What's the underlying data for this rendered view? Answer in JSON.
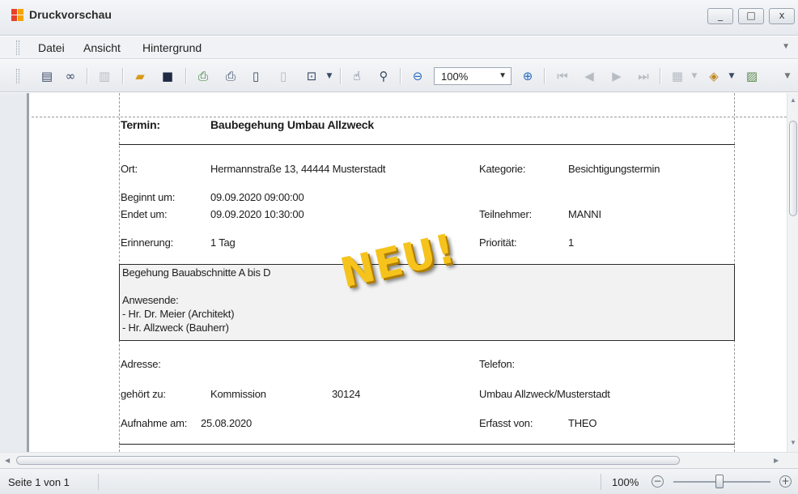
{
  "window": {
    "title": "Druckvorschau",
    "buttons": {
      "minimize": "_",
      "maximize": "□",
      "close": "x"
    }
  },
  "menu": [
    "Datei",
    "Ansicht",
    "Hintergrund"
  ],
  "toolbar": {
    "zoom_value": "100%",
    "icons": [
      "document-map-icon",
      "find-icon",
      "parameters-icon",
      "open-icon",
      "save-icon",
      "print-dialog-icon",
      "print-icon",
      "page-setup-icon",
      "scale-icon",
      "page-margins-icon",
      "hand-tool-icon",
      "magnifier-icon",
      "zoom-out-icon",
      "zoom-in-icon",
      "first-page-icon",
      "previous-page-icon",
      "next-page-icon",
      "last-page-icon",
      "multiple-pages-icon",
      "page-color-icon",
      "watermark-icon"
    ]
  },
  "report": {
    "termin_label": "Termin:",
    "termin_value": "Baubegehung Umbau Allzweck",
    "ort_label": "Ort:",
    "ort_value": "Hermannstraße 13, 44444 Musterstadt",
    "kategorie_label": "Kategorie:",
    "kategorie_value": "Besichtigungstermin",
    "beginn_label": "Beginnt um:",
    "beginn_value": "09.09.2020 09:00:00",
    "ende_label": "Endet um:",
    "ende_value": "09.09.2020 10:30:00",
    "teilnehmer_label": "Teilnehmer:",
    "teilnehmer_value": "MANNI",
    "erinnerung_label": "Erinnerung:",
    "erinnerung_value": "1 Tag",
    "prioritaet_label": "Priorität:",
    "prioritaet_value": "1",
    "notes": [
      "Begehung Bauabschnitte A bis D",
      "",
      "Anwesende:",
      "- Hr. Dr. Meier (Architekt)",
      "- Hr. Allzweck (Bauherr)"
    ],
    "adresse_label": "Adresse:",
    "telefon_label": "Telefon:",
    "gehoert_label": "gehört zu:",
    "gehoert_value": "Kommission",
    "kommission_nr": "30124",
    "projekt_value": "Umbau Allzweck/Musterstadt",
    "aufnahme_label": "Aufnahme am:",
    "aufnahme_value": "25.08.2020",
    "erfasst_label": "Erfasst von:",
    "erfasst_value": "THEO",
    "stamp": "NEU!"
  },
  "status": {
    "page": "Seite 1 von 1",
    "zoom": "100%",
    "zoom_level": 0.5
  },
  "colors": {
    "stamp": "#f6c31c",
    "accent": "#3a4a66"
  }
}
